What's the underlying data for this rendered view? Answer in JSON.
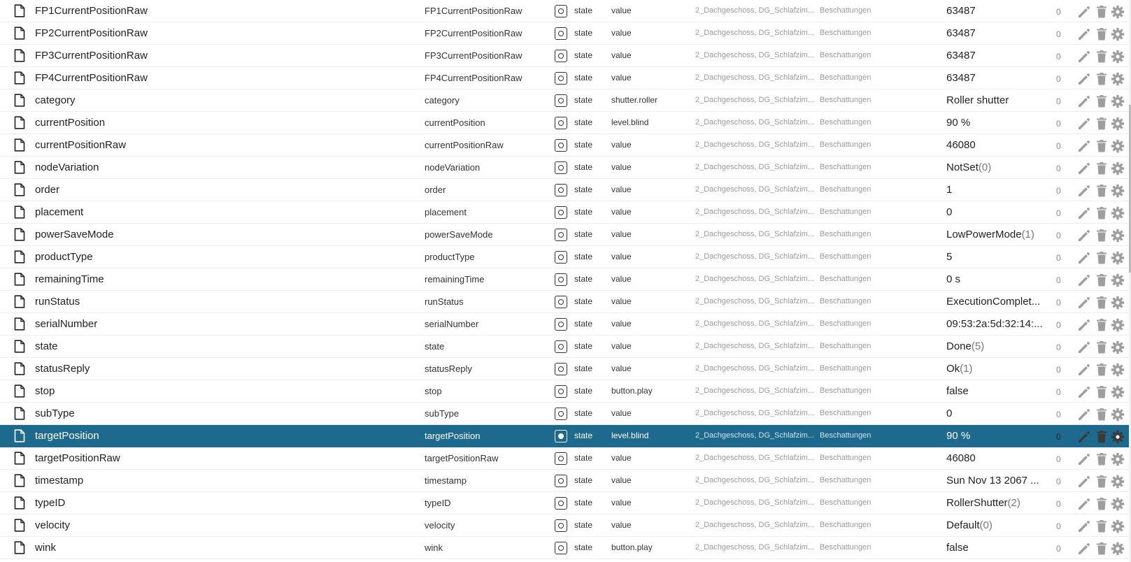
{
  "rows": [
    {
      "name": "FP1CurrentPositionRaw",
      "sname": "FP1CurrentPositionRaw",
      "type": "state",
      "role": "value",
      "room": "2_Dachgeschoss, DG_Schlafzim...",
      "func": "Beschattungen",
      "value": "63487",
      "value_sub": "",
      "ack": "0",
      "selected": false
    },
    {
      "name": "FP2CurrentPositionRaw",
      "sname": "FP2CurrentPositionRaw",
      "type": "state",
      "role": "value",
      "room": "2_Dachgeschoss, DG_Schlafzim...",
      "func": "Beschattungen",
      "value": "63487",
      "value_sub": "",
      "ack": "0",
      "selected": false
    },
    {
      "name": "FP3CurrentPositionRaw",
      "sname": "FP3CurrentPositionRaw",
      "type": "state",
      "role": "value",
      "room": "2_Dachgeschoss, DG_Schlafzim...",
      "func": "Beschattungen",
      "value": "63487",
      "value_sub": "",
      "ack": "0",
      "selected": false
    },
    {
      "name": "FP4CurrentPositionRaw",
      "sname": "FP4CurrentPositionRaw",
      "type": "state",
      "role": "value",
      "room": "2_Dachgeschoss, DG_Schlafzim...",
      "func": "Beschattungen",
      "value": "63487",
      "value_sub": "",
      "ack": "0",
      "selected": false
    },
    {
      "name": "category",
      "sname": "category",
      "type": "state",
      "role": "shutter.roller",
      "room": "2_Dachgeschoss, DG_Schlafzim...",
      "func": "Beschattungen",
      "value": "Roller shutter",
      "value_sub": "",
      "ack": "0",
      "selected": false
    },
    {
      "name": "currentPosition",
      "sname": "currentPosition",
      "type": "state",
      "role": "level.blind",
      "room": "2_Dachgeschoss, DG_Schlafzim...",
      "func": "Beschattungen",
      "value": "90 %",
      "value_sub": "",
      "ack": "0",
      "selected": false
    },
    {
      "name": "currentPositionRaw",
      "sname": "currentPositionRaw",
      "type": "state",
      "role": "value",
      "room": "2_Dachgeschoss, DG_Schlafzim...",
      "func": "Beschattungen",
      "value": "46080",
      "value_sub": "",
      "ack": "0",
      "selected": false
    },
    {
      "name": "nodeVariation",
      "sname": "nodeVariation",
      "type": "state",
      "role": "value",
      "room": "2_Dachgeschoss, DG_Schlafzim...",
      "func": "Beschattungen",
      "value": "NotSet",
      "value_sub": "(0)",
      "ack": "0",
      "selected": false
    },
    {
      "name": "order",
      "sname": "order",
      "type": "state",
      "role": "value",
      "room": "2_Dachgeschoss, DG_Schlafzim...",
      "func": "Beschattungen",
      "value": "1",
      "value_sub": "",
      "ack": "0",
      "selected": false
    },
    {
      "name": "placement",
      "sname": "placement",
      "type": "state",
      "role": "value",
      "room": "2_Dachgeschoss, DG_Schlafzim...",
      "func": "Beschattungen",
      "value": "0",
      "value_sub": "",
      "ack": "0",
      "selected": false
    },
    {
      "name": "powerSaveMode",
      "sname": "powerSaveMode",
      "type": "state",
      "role": "value",
      "room": "2_Dachgeschoss, DG_Schlafzim...",
      "func": "Beschattungen",
      "value": "LowPowerMode",
      "value_sub": "(1)",
      "ack": "0",
      "selected": false
    },
    {
      "name": "productType",
      "sname": "productType",
      "type": "state",
      "role": "value",
      "room": "2_Dachgeschoss, DG_Schlafzim...",
      "func": "Beschattungen",
      "value": "5",
      "value_sub": "",
      "ack": "0",
      "selected": false
    },
    {
      "name": "remainingTime",
      "sname": "remainingTime",
      "type": "state",
      "role": "value",
      "room": "2_Dachgeschoss, DG_Schlafzim...",
      "func": "Beschattungen",
      "value": "0 s",
      "value_sub": "",
      "ack": "0",
      "selected": false
    },
    {
      "name": "runStatus",
      "sname": "runStatus",
      "type": "state",
      "role": "value",
      "room": "2_Dachgeschoss, DG_Schlafzim...",
      "func": "Beschattungen",
      "value": "ExecutionComplet...",
      "value_sub": "",
      "ack": "0",
      "selected": false
    },
    {
      "name": "serialNumber",
      "sname": "serialNumber",
      "type": "state",
      "role": "value",
      "room": "2_Dachgeschoss, DG_Schlafzim...",
      "func": "Beschattungen",
      "value": "09:53:2a:5d:32:14:...",
      "value_sub": "",
      "ack": "0",
      "selected": false
    },
    {
      "name": "state",
      "sname": "state",
      "type": "state",
      "role": "value",
      "room": "2_Dachgeschoss, DG_Schlafzim...",
      "func": "Beschattungen",
      "value": "Done",
      "value_sub": "(5)",
      "ack": "0",
      "selected": false
    },
    {
      "name": "statusReply",
      "sname": "statusReply",
      "type": "state",
      "role": "value",
      "room": "2_Dachgeschoss, DG_Schlafzim...",
      "func": "Beschattungen",
      "value": "Ok",
      "value_sub": "(1)",
      "ack": "0",
      "selected": false
    },
    {
      "name": "stop",
      "sname": "stop",
      "type": "state",
      "role": "button.play",
      "room": "2_Dachgeschoss, DG_Schlafzim...",
      "func": "Beschattungen",
      "value": "false",
      "value_sub": "",
      "ack": "0",
      "selected": false
    },
    {
      "name": "subType",
      "sname": "subType",
      "type": "state",
      "role": "value",
      "room": "2_Dachgeschoss, DG_Schlafzim...",
      "func": "Beschattungen",
      "value": "0",
      "value_sub": "",
      "ack": "0",
      "selected": false
    },
    {
      "name": "targetPosition",
      "sname": "targetPosition",
      "type": "state",
      "role": "level.blind",
      "room": "2_Dachgeschoss, DG_Schlafzim...",
      "func": "Beschattungen",
      "value": "90 %",
      "value_sub": "",
      "ack": "0",
      "selected": true
    },
    {
      "name": "targetPositionRaw",
      "sname": "targetPositionRaw",
      "type": "state",
      "role": "value",
      "room": "2_Dachgeschoss, DG_Schlafzim...",
      "func": "Beschattungen",
      "value": "46080",
      "value_sub": "",
      "ack": "0",
      "selected": false
    },
    {
      "name": "timestamp",
      "sname": "timestamp",
      "type": "state",
      "role": "value",
      "room": "2_Dachgeschoss, DG_Schlafzim...",
      "func": "Beschattungen",
      "value": "Sun Nov 13 2067 ...",
      "value_sub": "",
      "ack": "0",
      "selected": false
    },
    {
      "name": "typeID",
      "sname": "typeID",
      "type": "state",
      "role": "value",
      "room": "2_Dachgeschoss, DG_Schlafzim...",
      "func": "Beschattungen",
      "value": "RollerShutter",
      "value_sub": "(2)",
      "ack": "0",
      "selected": false
    },
    {
      "name": "velocity",
      "sname": "velocity",
      "type": "state",
      "role": "value",
      "room": "2_Dachgeschoss, DG_Schlafzim...",
      "func": "Beschattungen",
      "value": "Default",
      "value_sub": "(0)",
      "ack": "0",
      "selected": false
    },
    {
      "name": "wink",
      "sname": "wink",
      "type": "state",
      "role": "button.play",
      "room": "2_Dachgeschoss, DG_Schlafzim...",
      "func": "Beschattungen",
      "value": "false",
      "value_sub": "",
      "ack": "0",
      "selected": false
    }
  ],
  "icons": {
    "row_icon": "file-icon",
    "type_icon": "state-icon",
    "edit": "pencil-icon",
    "delete": "trash-icon",
    "settings": "gear-icon"
  },
  "colors": {
    "selected_row": "#1e6a8f",
    "action_icon": "#9e9e9e"
  }
}
